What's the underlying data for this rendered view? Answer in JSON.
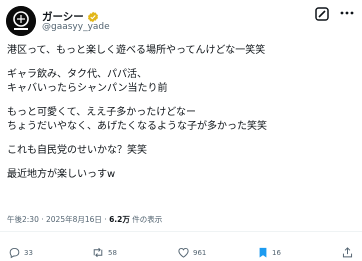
{
  "author": {
    "display_name": "ガーシー",
    "handle": "@gaasyy_yade",
    "verified_color": "#e2b719"
  },
  "post": {
    "lines": [
      "港区って、もっと楽しく遊べる場所やってんけどな一笑笑",
      "",
      "ギャラ飲み、タク代、パパ活、",
      "キャバいったらシャンパン当たり前",
      "",
      "もっと可愛くて、ええ子多かったけどなー",
      "ちょうだいやなく、あげたくなるような子が多かった笑笑",
      "",
      "これも自民党のせいかな？笑笑",
      "",
      "最近地方が楽しいっすw"
    ]
  },
  "meta": {
    "time": "午後2:30",
    "sep": "·",
    "date": "2025年8月16日",
    "views_count": "6.2万",
    "views_label": "件の表示"
  },
  "actions": {
    "replies": "33",
    "reposts": "58",
    "likes": "961",
    "bookmarks": "16"
  },
  "colors": {
    "text": "#0f1419",
    "secondary": "#536471",
    "divider": "#eff3f4"
  },
  "icons": [
    "avatar-logo",
    "verified-badge-icon",
    "grok-icon",
    "more-icon",
    "reply-icon",
    "repost-icon",
    "like-icon",
    "bookmark-icon",
    "share-icon"
  ]
}
